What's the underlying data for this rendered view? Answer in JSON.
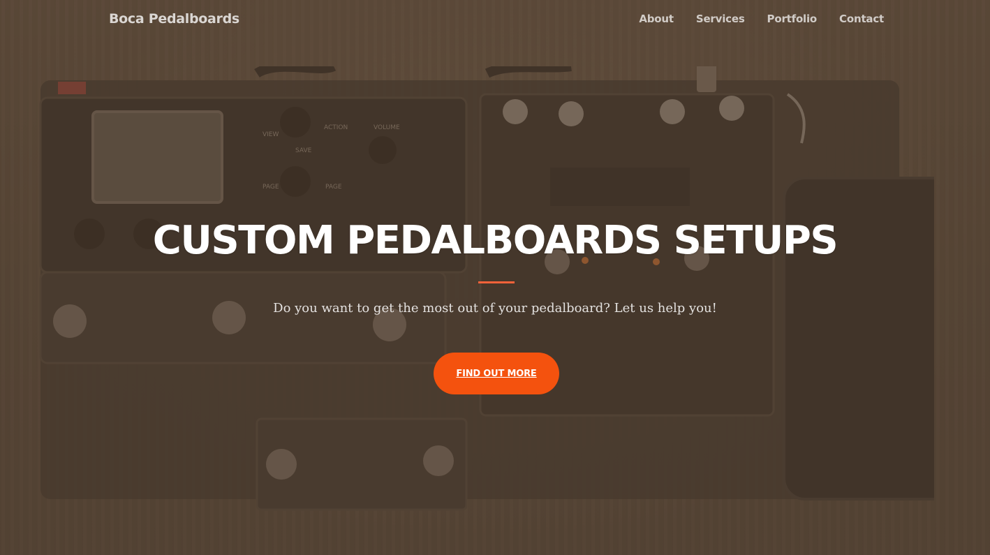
{
  "nav": {
    "brand": "Boca Pedalboards",
    "links": [
      "About",
      "Services",
      "Portfolio",
      "Contact"
    ]
  },
  "hero": {
    "title": "CUSTOM PEDALBOARDS SETUPS",
    "subtitle": "Do you want to get the most out of your pedalboard? Let us help you!",
    "cta_label": "FIND OUT MORE"
  },
  "colors": {
    "accent": "#f4520e",
    "divider": "#f4623a",
    "overlay": "#5c4634"
  },
  "background": {
    "unit_labels": [
      "VIEW",
      "ACTION",
      "SAVE",
      "VOLUME",
      "PAGE",
      "PAGE"
    ]
  }
}
